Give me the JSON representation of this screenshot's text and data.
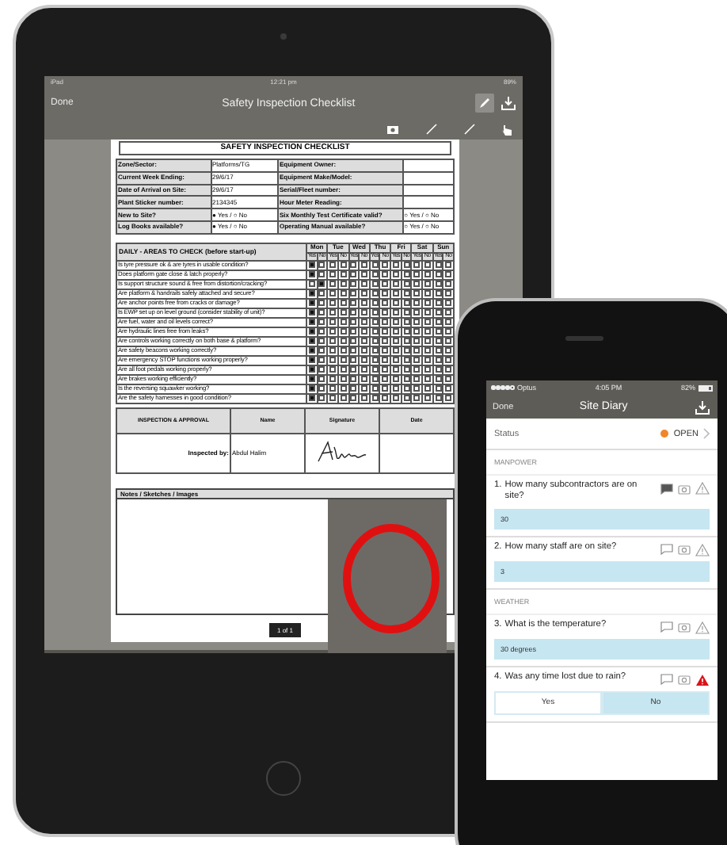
{
  "ipad": {
    "status_bar": {
      "device": "iPad",
      "time": "12:21 pm",
      "battery": "89%"
    },
    "nav": {
      "back": "Done",
      "title": "Safety Inspection Checklist",
      "pen_selected": true
    },
    "tools": [
      {
        "kind": "camera",
        "selected": false
      },
      {
        "kind": "line",
        "selected": false
      },
      {
        "kind": "line",
        "selected": false
      },
      {
        "kind": "touch",
        "selected": false
      }
    ],
    "document": {
      "title": "SAFETY INSPECTION CHECKLIST",
      "info_rows": [
        [
          "Zone/Sector:",
          "Platforms/TG",
          "Equipment Owner:",
          ""
        ],
        [
          "Current Week Ending:",
          "29/6/17",
          "Equipment Make/Model:",
          ""
        ],
        [
          "Date of Arrival on Site:",
          "29/6/17",
          "Serial/Fleet number:",
          ""
        ],
        [
          "Plant Sticker number:",
          "2134345",
          "Hour Meter Reading:",
          ""
        ],
        [
          "New to Site?",
          "● Yes / ○ No",
          "Six Monthly Test Certificate valid?",
          "○ Yes / ○ No"
        ],
        [
          "Log Books available?",
          "● Yes / ○ No",
          "Operating Manual available?",
          "○ Yes / ○ No"
        ]
      ],
      "daily_heading": "DAILY - AREAS TO CHECK (before start-up)",
      "days": [
        {
          "name": "Mon",
          "sub": [
            "Yes",
            "No"
          ]
        },
        {
          "name": "Tue",
          "sub": [
            "Yes",
            "No"
          ]
        },
        {
          "name": "Wed",
          "sub": [
            "Yes",
            "No"
          ]
        },
        {
          "name": "Thu",
          "sub": [
            "Yes",
            "No"
          ]
        },
        {
          "name": "Fri",
          "sub": [
            "Yes",
            "No"
          ]
        },
        {
          "name": "Sat",
          "sub": [
            "Yes",
            "No"
          ]
        },
        {
          "name": "Sun",
          "sub": [
            "Yes",
            "No"
          ]
        }
      ],
      "checks": [
        {
          "text": "Is tyre pressure ok & are tyres in usable condition?",
          "marks": [
            true,
            false,
            false,
            false,
            false,
            false,
            false,
            false,
            false,
            false,
            false,
            false,
            false,
            false
          ]
        },
        {
          "text": "Does platform gate close & latch properly?",
          "marks": [
            true,
            false,
            false,
            false,
            false,
            false,
            false,
            false,
            false,
            false,
            false,
            false,
            false,
            false
          ]
        },
        {
          "text": "Is support structure sound & free from distortion/cracking?",
          "marks": [
            false,
            true,
            false,
            false,
            false,
            false,
            false,
            false,
            false,
            false,
            false,
            false,
            false,
            false
          ]
        },
        {
          "text": "Are platform & handrails safely attached and secure?",
          "marks": [
            true,
            false,
            false,
            false,
            false,
            false,
            false,
            false,
            false,
            false,
            false,
            false,
            false,
            false
          ]
        },
        {
          "text": "Are anchor points free from cracks or damage?",
          "marks": [
            true,
            false,
            false,
            false,
            false,
            false,
            false,
            false,
            false,
            false,
            false,
            false,
            false,
            false
          ]
        },
        {
          "text": "Is EWP set up on level ground (consider stability of unit)?",
          "marks": [
            true,
            false,
            false,
            false,
            false,
            false,
            false,
            false,
            false,
            false,
            false,
            false,
            false,
            false
          ]
        },
        {
          "text": "Are fuel, water and oil levels correct?",
          "marks": [
            true,
            false,
            false,
            false,
            false,
            false,
            false,
            false,
            false,
            false,
            false,
            false,
            false,
            false
          ]
        },
        {
          "text": "Are hydraulic lines free from leaks?",
          "marks": [
            true,
            false,
            false,
            false,
            false,
            false,
            false,
            false,
            false,
            false,
            false,
            false,
            false,
            false
          ]
        },
        {
          "text": "Are controls working correctly on both base & platform?",
          "marks": [
            true,
            false,
            false,
            false,
            false,
            false,
            false,
            false,
            false,
            false,
            false,
            false,
            false,
            false
          ]
        },
        {
          "text": "Are safety beacons working correctly?",
          "marks": [
            true,
            false,
            false,
            false,
            false,
            false,
            false,
            false,
            false,
            false,
            false,
            false,
            false,
            false
          ]
        },
        {
          "text": "Are emergency STOP functions working properly?",
          "marks": [
            true,
            false,
            false,
            false,
            false,
            false,
            false,
            false,
            false,
            false,
            false,
            false,
            false,
            false
          ]
        },
        {
          "text": "Are all foot pedals working properly?",
          "marks": [
            true,
            false,
            false,
            false,
            false,
            false,
            false,
            false,
            false,
            false,
            false,
            false,
            false,
            false
          ]
        },
        {
          "text": "Are brakes working efficiently?",
          "marks": [
            true,
            false,
            false,
            false,
            false,
            false,
            false,
            false,
            false,
            false,
            false,
            false,
            false,
            false
          ]
        },
        {
          "text": "Is the reversing squawker working?",
          "marks": [
            true,
            false,
            false,
            false,
            false,
            false,
            false,
            false,
            false,
            false,
            false,
            false,
            false,
            false
          ]
        },
        {
          "text": "Are the safety harnesses in good condition?",
          "marks": [
            true,
            false,
            false,
            false,
            false,
            false,
            false,
            false,
            false,
            false,
            false,
            false,
            false,
            false
          ]
        }
      ],
      "approval": {
        "heading": "INSPECTION & APPROVAL",
        "columns": [
          "Name",
          "Signature",
          "Date"
        ],
        "label": "Inspected by:",
        "name": "Abdul Halim"
      },
      "notes_heading": "Notes / Sketches / Images"
    },
    "page_indicator": "1 of 1"
  },
  "iphone": {
    "status_bar": {
      "carrier": "Optus",
      "time": "4:05 PM",
      "battery": "82%"
    },
    "nav": {
      "back": "Done",
      "title": "Site Diary"
    },
    "status": {
      "label": "Status",
      "value": "OPEN",
      "color": "#f0862a"
    },
    "sections": [
      {
        "title": "MANPOWER",
        "questions": [
          {
            "number": "1.",
            "text": "How many subcontractors are on site?",
            "kind": "text",
            "answer": "30",
            "has_comment": true,
            "warning": false
          },
          {
            "number": "2.",
            "text": "How many staff are on site?",
            "kind": "text",
            "answer": "3",
            "has_comment": false,
            "warning": false
          }
        ]
      },
      {
        "title": "WEATHER",
        "questions": [
          {
            "number": "3.",
            "text": "What is the temperature?",
            "kind": "text",
            "answer": "30 degrees",
            "has_comment": false,
            "warning": false
          },
          {
            "number": "4.",
            "text": "Was any time lost due to rain?",
            "kind": "choice",
            "options": [
              {
                "label": "Yes",
                "selected": false
              },
              {
                "label": "No",
                "selected": true
              }
            ],
            "has_comment": false,
            "warning": true
          }
        ]
      }
    ]
  }
}
